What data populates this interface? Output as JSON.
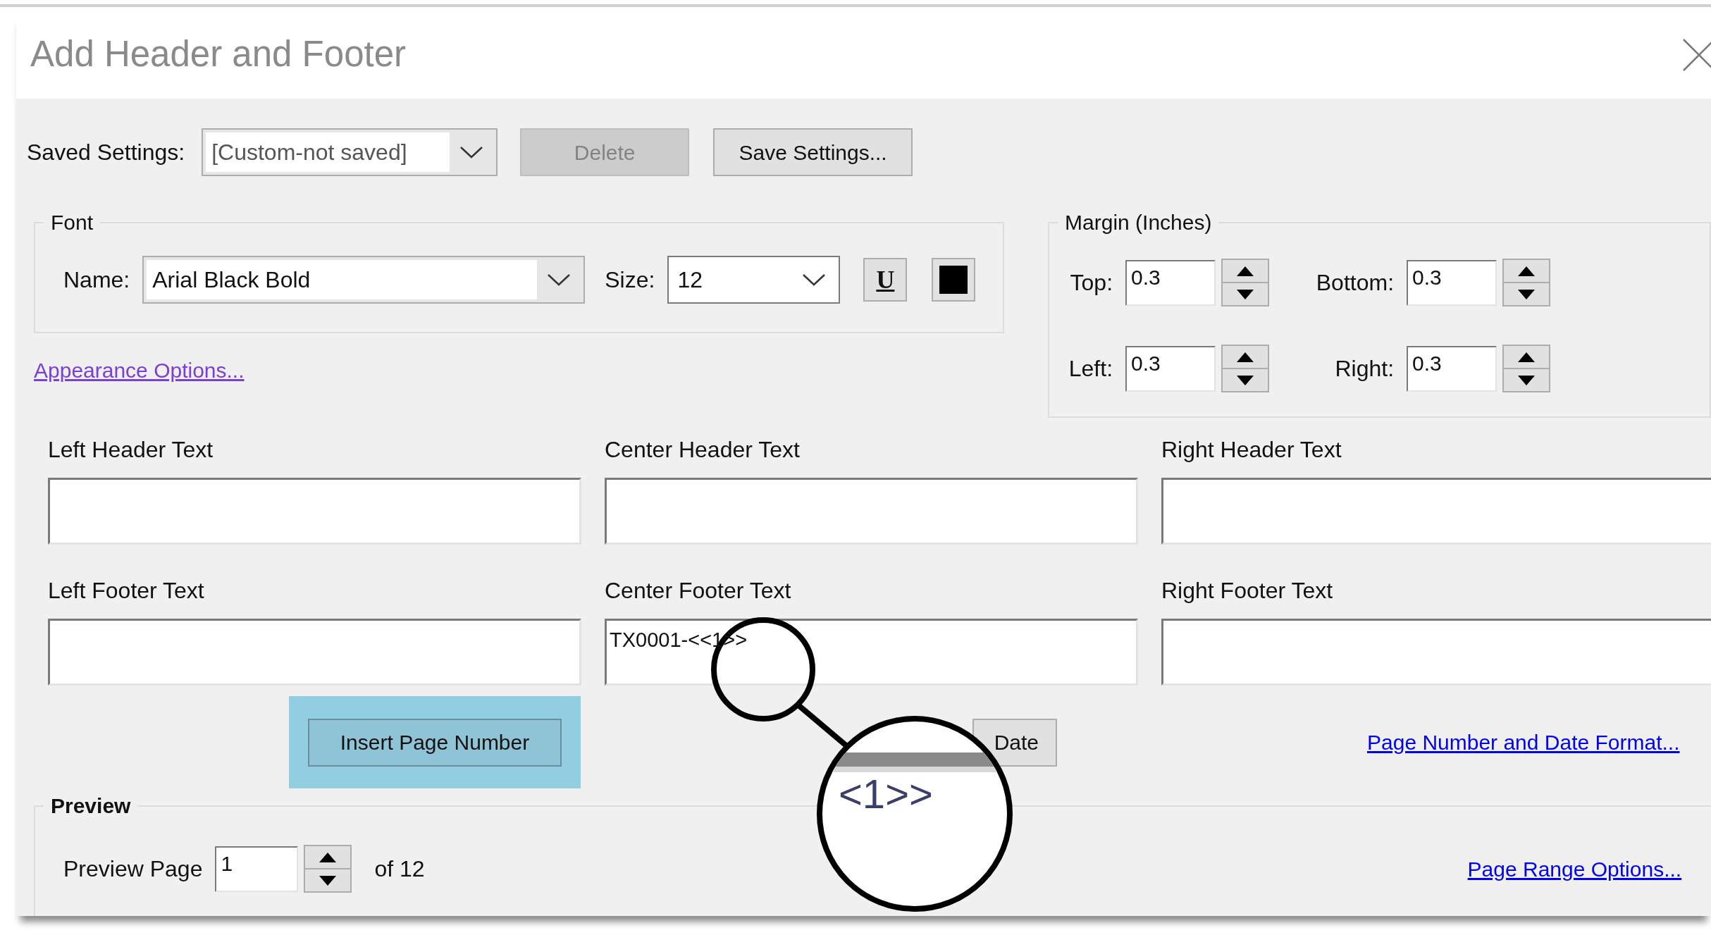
{
  "window": {
    "title": "Add Header and Footer"
  },
  "saved_settings": {
    "label": "Saved Settings:",
    "value": "[Custom-not saved]",
    "buttons": [
      {
        "label": "Delete",
        "disabled": true
      },
      {
        "label": "Save Settings...",
        "disabled": false
      }
    ]
  },
  "font": {
    "legend": "Font",
    "name_label": "Name:",
    "name_value": "Arial Black Bold",
    "size_label": "Size:",
    "size_value": "12",
    "underline_label": "U"
  },
  "margin": {
    "legend": "Margin (Inches)",
    "fields": [
      {
        "label": "Top:",
        "value": "0.3"
      },
      {
        "label": "Bottom:",
        "value": "0.3"
      },
      {
        "label": "Left:",
        "value": "0.3"
      },
      {
        "label": "Right:",
        "value": "0.3"
      }
    ]
  },
  "appearance_link": "Appearance Options...",
  "text_fields": [
    {
      "label": "Left Header Text"
    },
    {
      "label": "Center Header Text"
    },
    {
      "label": "Right Header Text"
    },
    {
      "label": "Left Footer Text"
    },
    {
      "label": "Center Footer Text",
      "value": "TX0001-<<1>>"
    },
    {
      "label": "Right Footer Text"
    }
  ],
  "insert_buttons": [
    {
      "label": "Insert Page Number",
      "highlighted": true
    },
    {
      "label": "Date",
      "highlighted": false
    }
  ],
  "format_link": "Page Number and Date Format...",
  "preview": {
    "legend": "Preview",
    "page_label": "Preview Page",
    "page_value": "1",
    "of_text": "of 12",
    "range_link": "Page Range Options..."
  },
  "magnifier": {
    "text": "<1>>"
  }
}
